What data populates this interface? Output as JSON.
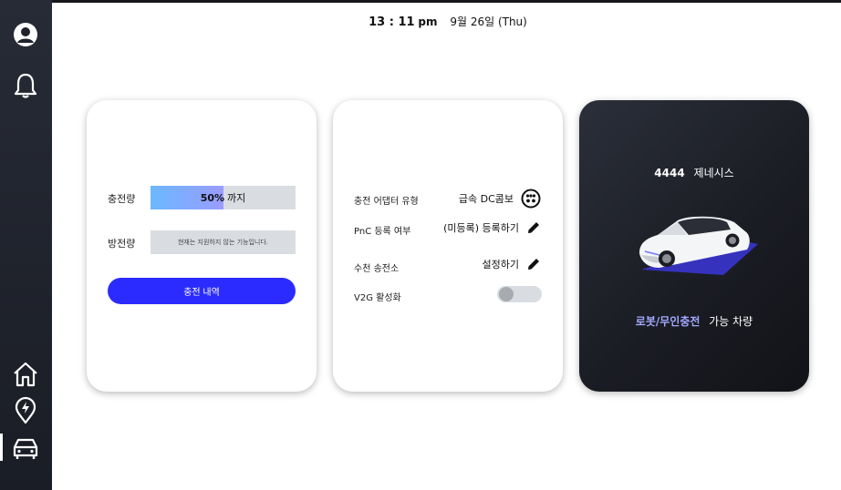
{
  "header": {
    "time": "13 : 11",
    "ampm": "pm",
    "date": "9월 26일 (Thu)"
  },
  "sidebar": {
    "items": [
      {
        "name": "profile",
        "icon": "user-circle-icon"
      },
      {
        "name": "notifications",
        "icon": "bell-icon"
      },
      {
        "name": "home",
        "icon": "home-icon"
      },
      {
        "name": "charging",
        "icon": "charging-pin-icon"
      },
      {
        "name": "vehicle",
        "icon": "car-icon",
        "active": true
      }
    ]
  },
  "charge_card": {
    "charge_label": "충전량",
    "charge_percent": "50%",
    "charge_suffix": "까지",
    "charge_fill": 0.5,
    "discharge_label": "방전량",
    "discharge_note": "현재는 지원하지 않는 기능입니다.",
    "history_button": "충전 내역"
  },
  "info_card": {
    "adapter_label": "충전 어댑터 유형",
    "adapter_value": "급속 DC콤보",
    "pnc_label": "PnC 등록 여부",
    "pnc_value": "(미등록) 등록하기",
    "station_label": "수천 송전소",
    "station_value": "설정하기",
    "v2g_label": "V2G 활성화",
    "v2g_enabled": false
  },
  "vehicle_card": {
    "number": "4444",
    "model": "제네시스",
    "highlight": "로봇/무인충전",
    "caption": "가능 차량"
  },
  "colors": {
    "accent": "#2b2bff",
    "highlight": "#a3a8ff",
    "sidebar": "#1f222b"
  }
}
